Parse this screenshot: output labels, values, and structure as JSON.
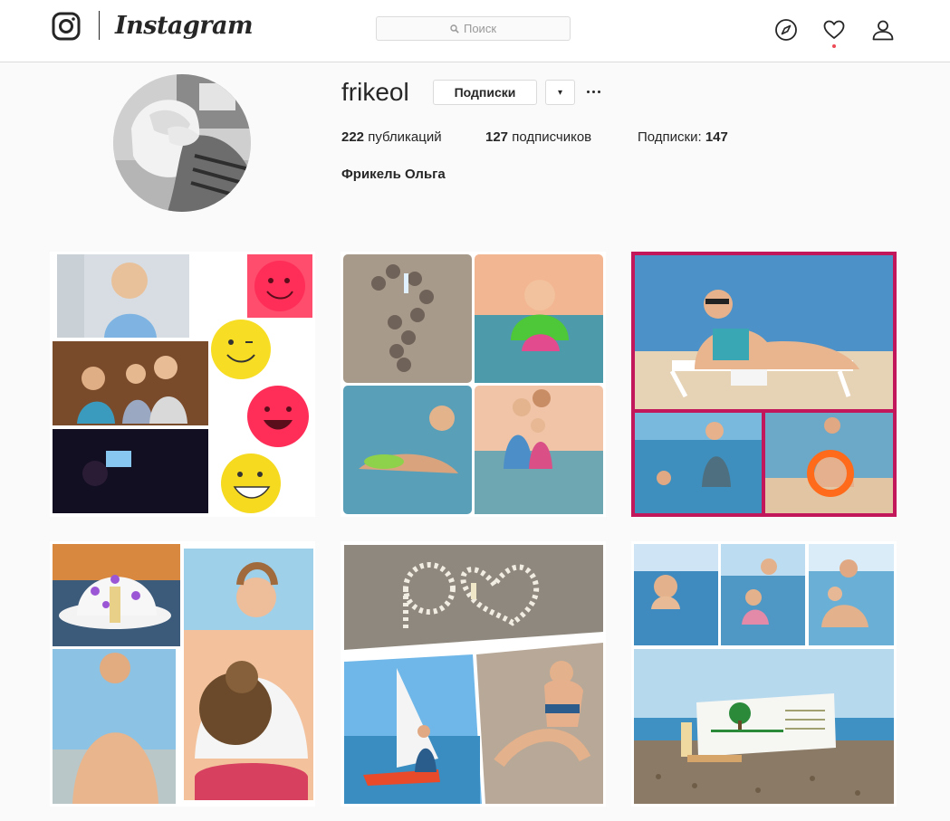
{
  "header": {
    "wordmark": "Instagram",
    "search_placeholder": "Поиск",
    "icons": [
      "instagram-glyph-icon",
      "search-icon",
      "compass-icon",
      "heart-icon",
      "user-icon"
    ],
    "notification_dot_color": "#ed4956"
  },
  "profile": {
    "username": "frikeol",
    "follow_button": "Подписки",
    "dropdown_icon": "▾",
    "more_icon": "ellipsis-icon",
    "posts_count": "222",
    "posts_label": " публикаций",
    "followers_count": "127",
    "followers_label": " подписчиков",
    "following_label": "Подписки: ",
    "following_count": "147",
    "full_name": "Фрикель Ольга"
  },
  "colors": {
    "background": "#fafafa",
    "border": "#dbdbdb",
    "text": "#262626",
    "highlight_frame": "#c2185b"
  },
  "posts": [
    {
      "row": 1,
      "col": 1
    },
    {
      "row": 1,
      "col": 2
    },
    {
      "row": 1,
      "col": 3
    },
    {
      "row": 2,
      "col": 1
    },
    {
      "row": 2,
      "col": 2
    },
    {
      "row": 2,
      "col": 3
    }
  ]
}
